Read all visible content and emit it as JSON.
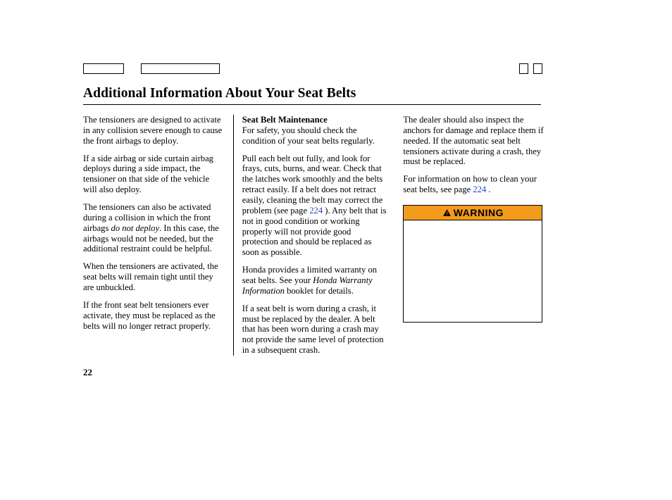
{
  "page_title": "Additional Information About Your Seat Belts",
  "page_number": "22",
  "col1": {
    "p1": "The tensioners are designed to activate in any collision severe enough to cause the front airbags to deploy.",
    "p2": "If a side airbag or side curtain airbag deploys during a side impact, the tensioner on that side of the vehicle will also deploy.",
    "p3_a": "The tensioners can also be activated during a collision in which the front airbags ",
    "p3_i": "do not deploy",
    "p3_b": ". In this case, the airbags would not be needed, but the additional restraint could be helpful.",
    "p4": "When the tensioners are activated, the seat belts will remain tight until they are unbuckled.",
    "p5": "If the front seat belt tensioners ever activate, they must be replaced as the belts will no longer retract properly."
  },
  "col2": {
    "heading": "Seat Belt Maintenance",
    "p1": "For safety, you should check the condition of your seat belts regularly.",
    "p2_a": "Pull each belt out fully, and look for frays, cuts, burns, and wear. Check that the latches work smoothly and the belts retract easily. If a belt does not retract easily, cleaning the belt may correct the problem (see page ",
    "p2_link": "224",
    "p2_b": " ). Any belt that is not in good condition or working properly will not provide good protection and should be replaced as soon as possible.",
    "p3_a": "Honda provides a limited warranty on seat belts. See your ",
    "p3_i": "Honda Warranty Information",
    "p3_b": " booklet for details.",
    "p4": "If a seat belt is worn during a crash, it must be replaced by the dealer. A belt that has been worn during a crash may not provide the same level of protection in a subsequent crash."
  },
  "col3": {
    "p1": "The dealer should also inspect the anchors for damage and replace them if needed. If the automatic seat belt tensioners activate during a crash, they must be replaced.",
    "p2_a": "For information on how to clean your seat belts, see page ",
    "p2_link": "224",
    "p2_b": " .",
    "warning_label": "WARNING"
  }
}
